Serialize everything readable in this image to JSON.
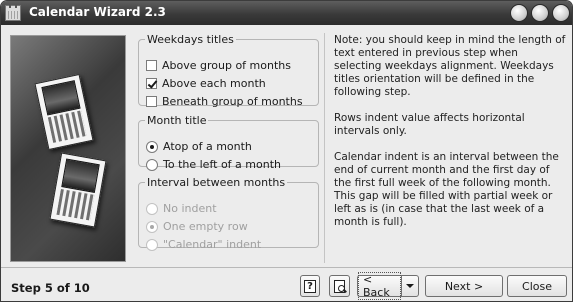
{
  "window": {
    "title": "Calendar Wizard 2.3"
  },
  "groups": {
    "weekdays": {
      "legend": "Weekdays titles",
      "options": [
        {
          "label": "Above group of months",
          "checked": false
        },
        {
          "label": "Above each month",
          "checked": true
        },
        {
          "label": "Beneath group of months",
          "checked": false
        }
      ]
    },
    "month_title": {
      "legend": "Month title",
      "options": [
        {
          "label": "Atop of a month",
          "selected": true
        },
        {
          "label": "To the left of a month",
          "selected": false
        }
      ]
    },
    "interval": {
      "legend": "Interval between months",
      "enabled": false,
      "options": [
        {
          "label": "No indent",
          "selected": false
        },
        {
          "label": "One empty row",
          "selected": true
        },
        {
          "label": "\"Calendar\" indent",
          "selected": false
        }
      ]
    }
  },
  "notes": [
    "Note: you should keep in mind the length of text entered in previous step when selecting weekdays alignment. Weekdays titles orientation will be defined in the following step.",
    "Rows indent value affects horizontal intervals only.",
    "Calendar indent is an interval between the end of current month and the first day of the first full week of the following month. This gap will be filled with partial week or left as is (in case that the last week of a month is full)."
  ],
  "footer": {
    "step": "Step 5 of 10",
    "help_glyph": "?",
    "back": "< Back",
    "next": "Next >",
    "close": "Close"
  },
  "icons": [
    "app-calendar-icon",
    "help-icon",
    "preview-icon",
    "dropdown-caret-icon"
  ]
}
